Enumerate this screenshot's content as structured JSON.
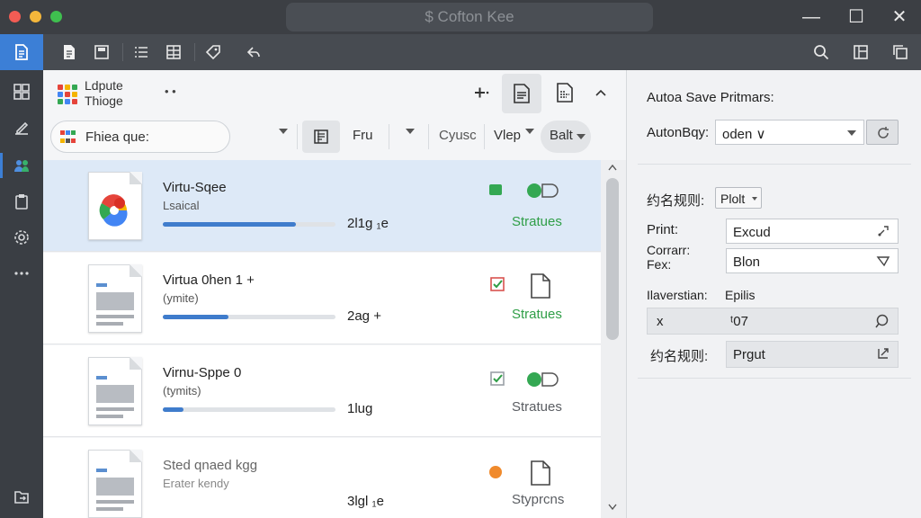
{
  "window": {
    "title": "$ Cofton Kee",
    "controls": [
      "—",
      "☐",
      "✕"
    ]
  },
  "main_header": {
    "app_name_line1": "Ldpute",
    "app_name_line2": "Thioge",
    "dots": "• •"
  },
  "filter_bar": {
    "search_text": "Fhiea que:",
    "fru_label": "Fru",
    "cyusc_label": "Cyusc",
    "vlep_label": "Vlep",
    "balt_label": "Balt"
  },
  "rows": [
    {
      "title": "Virtu-Sqee",
      "subtitle": "Lsaical",
      "size": "2l1g ₁e",
      "status": "Stratues",
      "progress": 0.77
    },
    {
      "title": "Virtua 0hen 1 +",
      "subtitle": "(ymite)",
      "size": "2ag +",
      "status": "Stratues",
      "progress": 0.38
    },
    {
      "title": "Virnu-Sppe 0",
      "subtitle": "(tymits)",
      "size": "1lug",
      "status": "Stratues",
      "progress": 0.12
    },
    {
      "title": "Sted qnaed kgg",
      "subtitle": "Erater kendy",
      "size": "3lgl ₁e",
      "status": "Styprcns",
      "progress": 0.0
    }
  ],
  "panel": {
    "title": "Autoa Save Pritmars:",
    "autonbay_label": "AutonBqy:",
    "autonbay_value": "oden ∨",
    "naming_label_1": "约名规则:",
    "naming_value_1": "Plolt",
    "print_label": "Print:",
    "print_value": "Excud",
    "corrarr_label": "Corrarr:",
    "fex_label": "Fex:",
    "fex_value": "Blon",
    "ilaverstian_label": "Ilaverstian:",
    "epilus_label": "Epilis",
    "search_x": "x",
    "search_value": "ᵗ07",
    "naming_label_2": "约名规则:",
    "naming_value_2": "Prgut"
  },
  "colors": {
    "accent": "#3c7fd6",
    "status_green": "#2f9e47",
    "warning_orange": "#f08a2c",
    "selection": "#dde9f7"
  },
  "icons": {
    "rail": [
      "document-icon",
      "grid-icon",
      "edit-icon",
      "users-icon",
      "clipboard-icon",
      "gear-icon",
      "more-icon",
      "folder-export-icon"
    ],
    "toolbar": [
      "new-file-icon",
      "save-icon",
      "list-icon",
      "table-icon",
      "tag-icon",
      "share-icon",
      "search-icon",
      "layout-icon",
      "copy-icon"
    ]
  }
}
